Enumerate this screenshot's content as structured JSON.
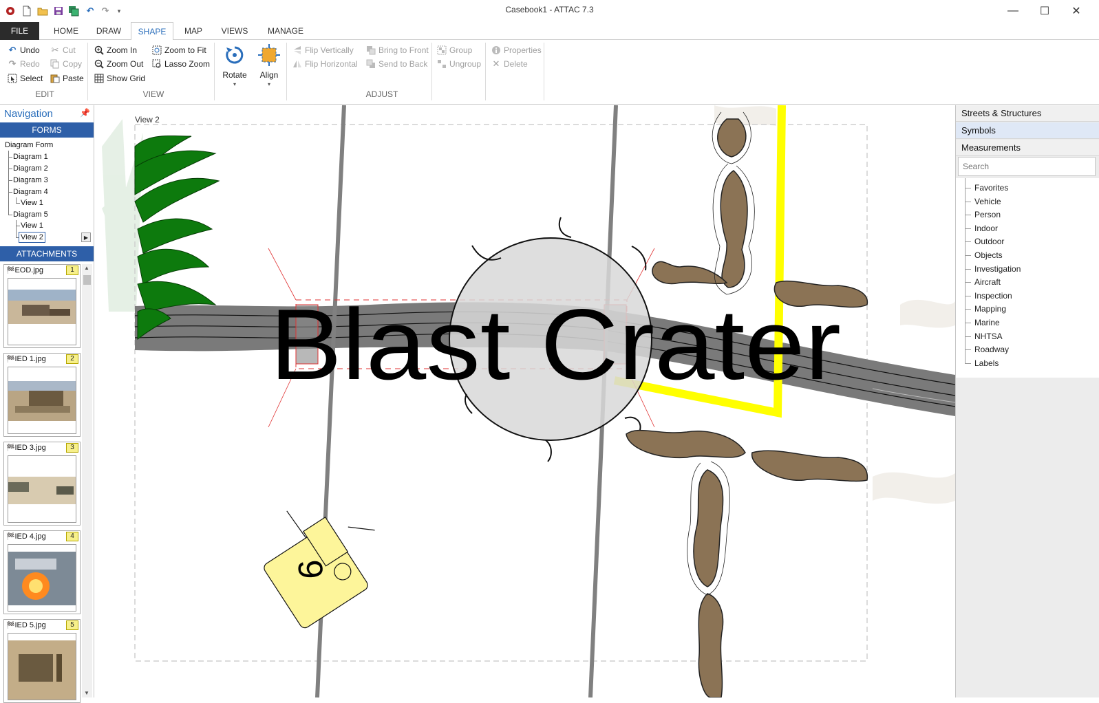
{
  "window": {
    "title": "Casebook1 - ATTAC 7.3",
    "minimize": "—",
    "maximize": "☐",
    "close": "✕"
  },
  "ribbon_tabs": [
    "FILE",
    "HOME",
    "DRAW",
    "SHAPE",
    "MAP",
    "VIEWS",
    "MANAGE"
  ],
  "ribbon": {
    "edit": {
      "undo": "Undo",
      "redo": "Redo",
      "select": "Select",
      "cut": "Cut",
      "copy": "Copy",
      "paste": "Paste",
      "label": "EDIT"
    },
    "view": {
      "zoom_in": "Zoom In",
      "zoom_out": "Zoom Out",
      "show_grid": "Show Grid",
      "zoom_fit": "Zoom to Fit",
      "lasso_zoom": "Lasso Zoom",
      "label": "VIEW"
    },
    "rotate": "Rotate",
    "align": "Align",
    "adjust": {
      "flip_v": "Flip Vertically",
      "flip_h": "Flip Horizontal",
      "bring_front": "Bring to Front",
      "send_back": "Send to Back",
      "group": "Group",
      "ungroup": "Ungroup",
      "properties": "Properties",
      "delete": "Delete",
      "label": "ADJUST"
    }
  },
  "navigation": {
    "title": "Navigation",
    "forms_header": "FORMS",
    "tree": {
      "root": "Diagram Form",
      "d1": "Diagram 1",
      "d2": "Diagram 2",
      "d3": "Diagram 3",
      "d4": "Diagram 4",
      "d4v1": "View 1",
      "d5": "Diagram 5",
      "d5v1": "View 1",
      "d5v2": "View 2"
    },
    "attachments_header": "ATTACHMENTS",
    "attachments": [
      {
        "name": "EOD.jpg",
        "num": "1"
      },
      {
        "name": "IED 1.jpg",
        "num": "2"
      },
      {
        "name": "IED 3.jpg",
        "num": "3"
      },
      {
        "name": "IED 4.jpg",
        "num": "4"
      },
      {
        "name": "IED 5.jpg",
        "num": "5"
      }
    ]
  },
  "canvas": {
    "view_label": "View 2",
    "crater_text": "Blast Crater",
    "marker_number": "9"
  },
  "right_panel": {
    "tabs": [
      "Streets & Structures",
      "Symbols",
      "Measurements"
    ],
    "search_placeholder": "Search",
    "categories": [
      "Favorites",
      "Vehicle",
      "Person",
      "Indoor",
      "Outdoor",
      "Objects",
      "Investigation",
      "Aircraft",
      "Inspection",
      "Mapping",
      "Marine",
      "NHTSA",
      "Roadway",
      "Labels"
    ]
  },
  "colors": {
    "accent": "#2a6ebb",
    "section_header": "#2e5fa8",
    "road": "#7a7a7a",
    "tree_green": "#0d7a0d",
    "mud": "#8b7355",
    "highlight_yellow": "#ffff00",
    "marker_yellow": "#fdf59a"
  }
}
